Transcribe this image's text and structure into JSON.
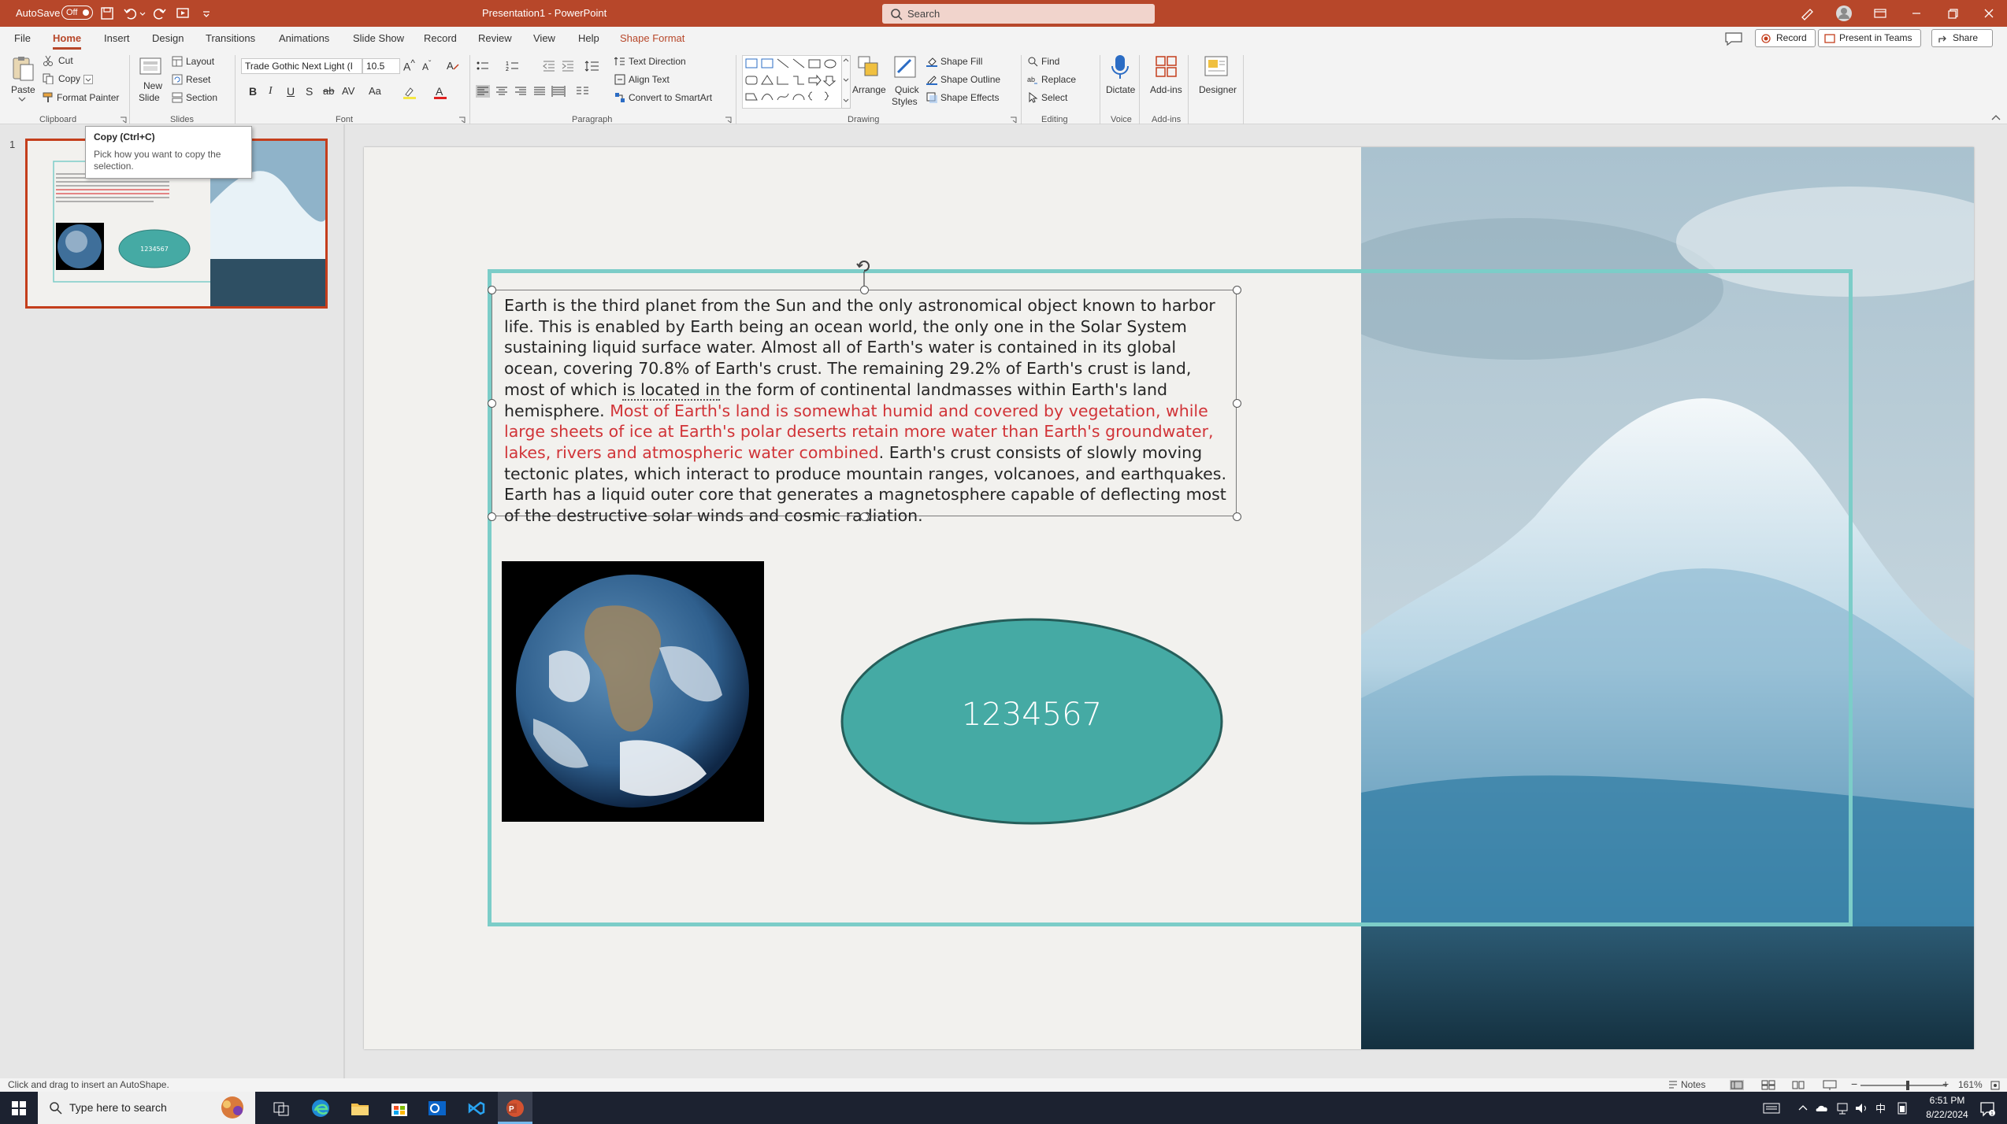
{
  "title_bar": {
    "autosave_label": "AutoSave",
    "autosave_state": "Off",
    "document_title": "Presentation1  -  PowerPoint",
    "search_placeholder": "Search",
    "accent_color": "#b7472a"
  },
  "menu": {
    "tabs": [
      "File",
      "Home",
      "Insert",
      "Design",
      "Transitions",
      "Animations",
      "Slide Show",
      "Record",
      "Review",
      "View",
      "Help",
      "Shape Format"
    ],
    "active_tab": "Home",
    "record_button": "Record",
    "present_in_teams": "Present in Teams",
    "share": "Share"
  },
  "ribbon": {
    "clipboard": {
      "paste": "Paste",
      "cut": "Cut",
      "copy": "Copy",
      "format_painter": "Format Painter",
      "group": "Clipboard"
    },
    "slides": {
      "new_slide": "New Slide",
      "new_slide_l1": "New",
      "new_slide_l2": "Slide",
      "layout": "Layout",
      "reset": "Reset",
      "section": "Section",
      "group": "Slides"
    },
    "font": {
      "name": "Trade Gothic Next Light (I",
      "size": "10.5",
      "group": "Font"
    },
    "paragraph": {
      "text_direction": "Text Direction",
      "align_text": "Align Text",
      "convert_smartart": "Convert to SmartArt",
      "group": "Paragraph"
    },
    "drawing": {
      "arrange": "Arrange",
      "quick_styles_l1": "Quick",
      "quick_styles_l2": "Styles",
      "shape_fill": "Shape Fill",
      "shape_outline": "Shape Outline",
      "shape_effects": "Shape Effects",
      "group": "Drawing"
    },
    "editing": {
      "find": "Find",
      "replace": "Replace",
      "select": "Select",
      "group": "Editing"
    },
    "voice": {
      "dictate": "Dictate",
      "group": "Voice"
    },
    "addins": {
      "addins": "Add-ins",
      "group": "Add-ins"
    },
    "designer": {
      "designer": "Designer"
    }
  },
  "tooltip": {
    "title": "Copy (Ctrl+C)",
    "body": "Pick how you want to copy the selection."
  },
  "thumbnail": {
    "number": "1",
    "ellipse_text": "1234567"
  },
  "slide": {
    "text_part1": "Earth is the third planet from the Sun and the only astronomical object known to harbor life. This is enabled by Earth being an ocean world, the only one in the Solar System sustaining liquid surface water. Almost all of Earth's water is contained in its global ocean, covering 70.8% of Earth's crust. The remaining 29.2% of Earth's crust is land, most of which ",
    "text_underlined": "is located in",
    "text_part2": " the form of continental landmasses within Earth's land hemisphere. ",
    "text_red": "Most of Earth's land is somewhat humid and covered by vegetation, while large sheets of ice at Earth's polar deserts retain more water than Earth's groundwater, lakes, rivers and atmospheric water combined",
    "text_part3": ". Earth's crust consists of slowly moving tectonic plates, which interact to produce mountain ranges, volcanoes, and earthquakes. Earth has a liquid outer core that generates a magnetosphere capable of deflecting most of the destructive solar winds and cosmic radiation.",
    "ellipse_text": "1234567",
    "ellipse_color": "#45aaa4",
    "frame_color": "#7ccdc8",
    "red_text_color": "#d13438"
  },
  "status_bar": {
    "message": "Click and drag to insert an AutoShape.",
    "notes": "Notes",
    "zoom": "161%"
  },
  "taskbar": {
    "search_placeholder": "Type here to search",
    "time": "6:51 PM",
    "date": "8/22/2024"
  }
}
